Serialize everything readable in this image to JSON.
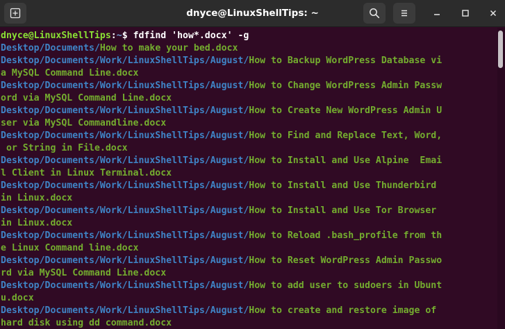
{
  "window": {
    "title": "dnyce@LinuxShellTips: ~"
  },
  "icons": {
    "new_tab": "new-tab-icon",
    "search": "search-icon",
    "menu": "hamburger-menu-icon",
    "minimize": "minimize-icon",
    "maximize": "maximize-icon",
    "close": "close-icon"
  },
  "colors": {
    "background": "#300a24",
    "directory": "#3f84c6",
    "filename": "#74ad2f",
    "prompt_user": "#8ae234",
    "prompt_path": "#729fcf"
  },
  "prompt": {
    "user_host": "dnyce@LinuxShellTips",
    "separator": ":",
    "path": "~",
    "symbol": "$ ",
    "command": "fdfind 'how*.docx' -g"
  },
  "lines": [
    {
      "dir": "Desktop/Documents/",
      "file": "How to make your bed.docx"
    },
    {
      "dir": "Desktop/Documents/Work/LinuxShellTips/August/",
      "file": "How to Backup WordPress Database vi"
    },
    {
      "dir": "",
      "file": "a MySQL Command Line.docx"
    },
    {
      "dir": "Desktop/Documents/Work/LinuxShellTips/August/",
      "file": "How to Change WordPress Admin Passw"
    },
    {
      "dir": "",
      "file": "ord via MySQL Command Line.docx"
    },
    {
      "dir": "Desktop/Documents/Work/LinuxShellTips/August/",
      "file": "How to Create New WordPress Admin U"
    },
    {
      "dir": "",
      "file": "ser via MySQL Commandline.docx"
    },
    {
      "dir": "Desktop/Documents/Work/LinuxShellTips/August/",
      "file": "How to Find and Replace Text, Word,"
    },
    {
      "dir": "",
      "file": " or String in File.docx"
    },
    {
      "dir": "Desktop/Documents/Work/LinuxShellTips/August/",
      "file": "How to Install and Use Alpine  Emai"
    },
    {
      "dir": "",
      "file": "l Client in Linux Terminal.docx"
    },
    {
      "dir": "Desktop/Documents/Work/LinuxShellTips/August/",
      "file": "How to Install and Use Thunderbird"
    },
    {
      "dir": "",
      "file": "in Linux.docx"
    },
    {
      "dir": "Desktop/Documents/Work/LinuxShellTips/August/",
      "file": "How to Install and Use Tor Browser"
    },
    {
      "dir": "",
      "file": "in Linux.docx"
    },
    {
      "dir": "Desktop/Documents/Work/LinuxShellTips/August/",
      "file": "How to Reload .bash_profile from th"
    },
    {
      "dir": "",
      "file": "e Linux Command line.docx"
    },
    {
      "dir": "Desktop/Documents/Work/LinuxShellTips/August/",
      "file": "How to Reset WordPress Admin Passwo"
    },
    {
      "dir": "",
      "file": "rd via MySQL Command Line.docx"
    },
    {
      "dir": "Desktop/Documents/Work/LinuxShellTips/August/",
      "file": "How to add user to sudoers in Ubunt"
    },
    {
      "dir": "",
      "file": "u.docx"
    },
    {
      "dir": "Desktop/Documents/Work/LinuxShellTips/August/",
      "file": "How to create and restore image of"
    },
    {
      "dir": "",
      "file": "hard disk using dd command.docx"
    }
  ]
}
